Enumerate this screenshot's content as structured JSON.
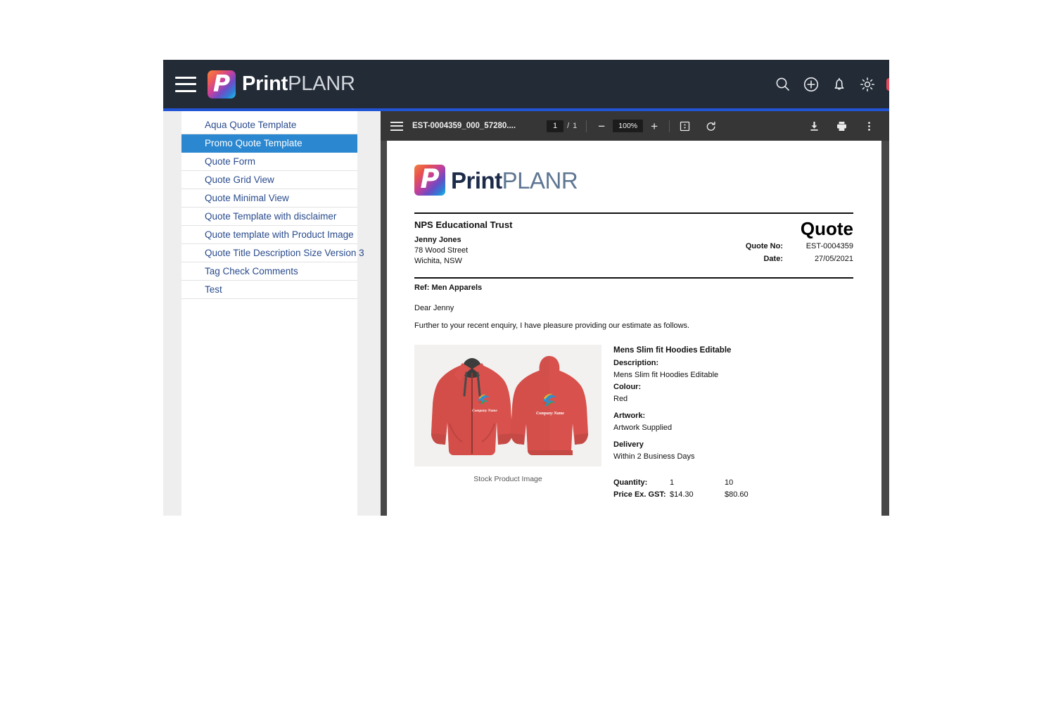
{
  "app": {
    "brand_bold": "Print",
    "brand_light": "PLANR",
    "logo_letter": "P",
    "menu_icon": "hamburger-icon",
    "header_icons": [
      "search-icon",
      "add-circle-icon",
      "bell-icon",
      "gear-icon"
    ],
    "accent_color": "#2255d6",
    "header_bg": "#232b36"
  },
  "sidebar": {
    "items": [
      {
        "label": "Aqua Quote Template",
        "active": false
      },
      {
        "label": "Promo Quote Template",
        "active": true
      },
      {
        "label": "Quote Form",
        "active": false
      },
      {
        "label": "Quote Grid View",
        "active": false
      },
      {
        "label": "Quote Minimal View",
        "active": false
      },
      {
        "label": "Quote Template with disclaimer",
        "active": false
      },
      {
        "label": "Quote template with Product Image",
        "active": false
      },
      {
        "label": "Quote Title Description Size Version 3",
        "active": false
      },
      {
        "label": "Tag Check Comments",
        "active": false
      },
      {
        "label": "Test",
        "active": false
      }
    ],
    "active_color": "#2a87d0",
    "link_color": "#2a4b8d"
  },
  "pdf_toolbar": {
    "sidebar_toggle_icon": "hamburger-icon",
    "filename": "EST-0004359_000_57280....",
    "page_current": "1",
    "page_separator": "/",
    "page_total": "1",
    "zoom_out_label": "−",
    "zoom_value": "100%",
    "zoom_in_label": "+",
    "fit_icon": "fit-page-icon",
    "rotate_icon": "rotate-icon",
    "download_icon": "download-icon",
    "print_icon": "print-icon",
    "more_icon": "more-vertical-icon"
  },
  "document": {
    "logo_letter": "P",
    "brand_bold": "Print",
    "brand_light": "PLANR",
    "customer": {
      "company": "NPS Educational Trust",
      "contact": "Jenny Jones",
      "address_line1": "78 Wood Street",
      "address_line2": "Wichita, NSW"
    },
    "quote_title": "Quote",
    "meta": [
      {
        "label": "Quote No:",
        "value": "EST-0004359"
      },
      {
        "label": "Date:",
        "value": "27/05/2021"
      }
    ],
    "reference": "Ref: Men Apparels",
    "greeting": "Dear Jenny",
    "intro": "Further to your recent enquiry, I have pleasure providing our estimate as follows.",
    "product": {
      "title": "Mens Slim fit Hoodies Editable",
      "image_caption": "Stock Product Image",
      "image_logo_text": "Company Name",
      "fields": [
        {
          "label": "Description:",
          "value": "Mens Slim fit Hoodies Editable"
        },
        {
          "label": "Colour:",
          "value": "Red"
        },
        {
          "label": "Artwork:",
          "value": "Artwork Supplied"
        },
        {
          "label": "Delivery",
          "value": "Within 2 Business Days"
        }
      ],
      "pricing": {
        "quantity_label": "Quantity:",
        "price_label": "Price Ex. GST:",
        "quantities": [
          "1",
          "10"
        ],
        "prices": [
          "$14.30",
          "$80.60"
        ]
      }
    }
  }
}
